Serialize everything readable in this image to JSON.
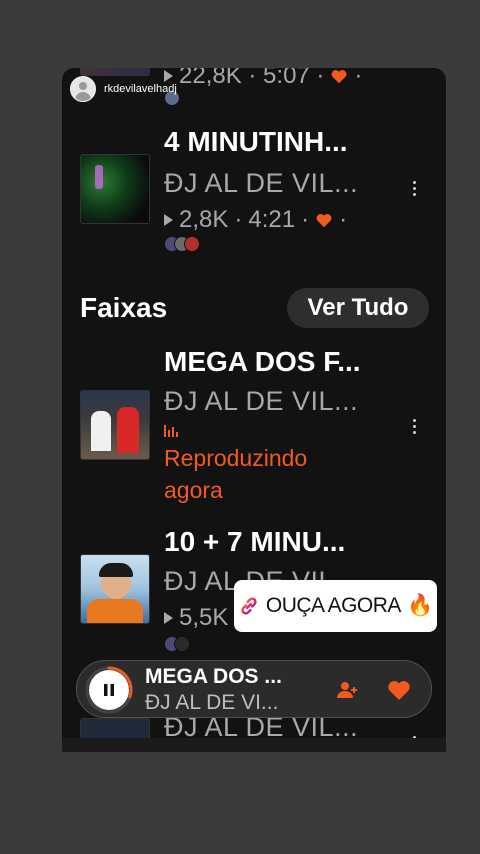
{
  "story": {
    "username": "rkdevilavelhadj"
  },
  "tracks_top": [
    {
      "stats": "22,8K · 5:07 ·"
    },
    {
      "title": "4 MINUTINH...",
      "artist": "ĐJ AL DE VIL...",
      "plays": "2,8K",
      "duration": "4:21",
      "suffix": "·"
    }
  ],
  "section": {
    "title": "Faixas",
    "see_all_label": "Ver Tudo"
  },
  "tracks": [
    {
      "title": "MEGA DOS F...",
      "artist": "ĐJ AL DE VIL...",
      "status_line1": "Reproduzindo",
      "status_line2": "agora"
    },
    {
      "title": "10 + 7 MINU...",
      "artist": "ĐJ AL DE VIL...",
      "plays": "5,5K"
    },
    {
      "artist": "ĐJ AL DE VIL..."
    }
  ],
  "link_sticker": {
    "label": "OUÇA AGORA",
    "emoji": "🔥"
  },
  "mini_player": {
    "title": "MEGA DOS ...",
    "artist": "ĐJ AL DE VI...",
    "progress": 0.3
  },
  "colors": {
    "accent": "#f25a22",
    "background": "#121212",
    "page_bg": "#3b3b3c"
  },
  "icons": [
    "user-avatar-icon",
    "play-count-icon",
    "heart-icon",
    "more-icon",
    "equalizer-icon",
    "link-icon",
    "fire-emoji",
    "pause-icon",
    "follow-icon"
  ]
}
